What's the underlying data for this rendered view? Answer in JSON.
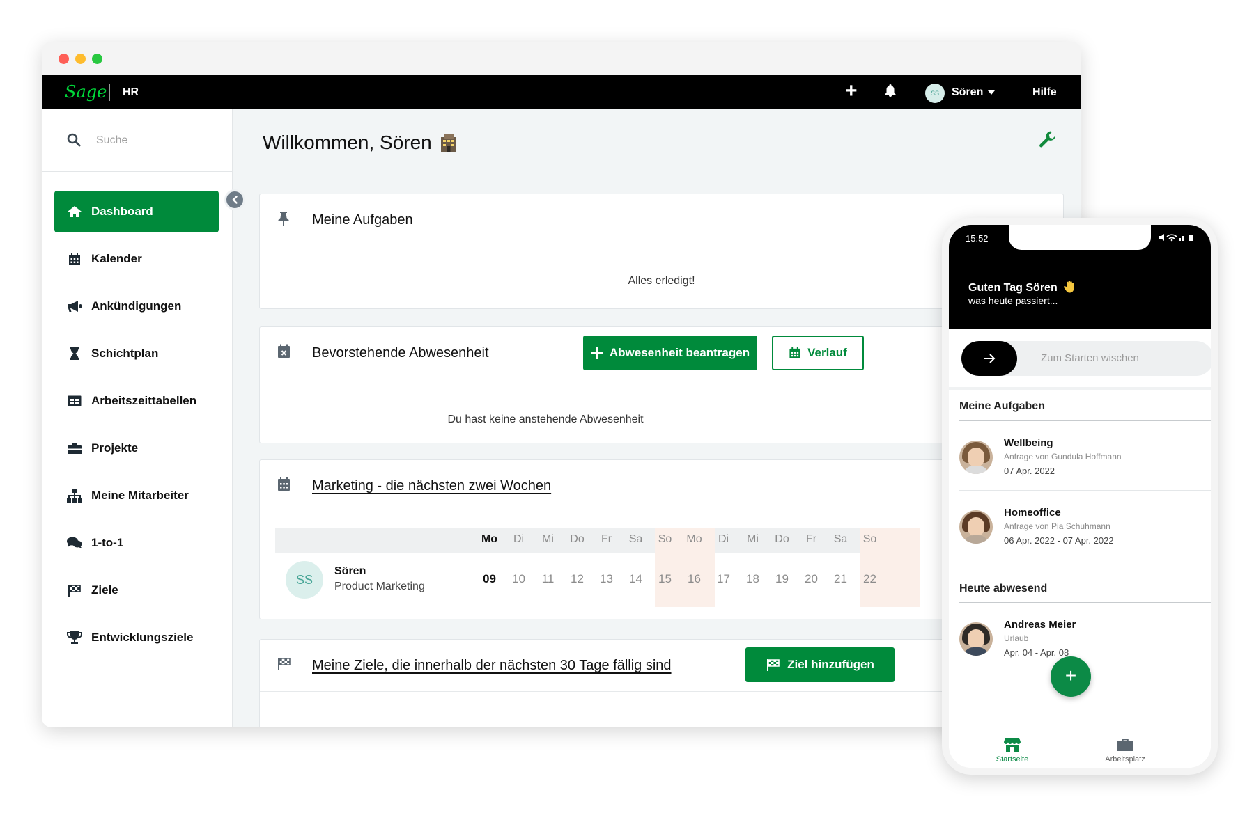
{
  "colors": {
    "brand_green": "#008a3b",
    "topbar": "#000000",
    "weekend": "#fbefe9",
    "sage_logo": "#00d639"
  },
  "topbar": {
    "logo_text": "Sage",
    "app_label": "HR",
    "add_icon": "plus-icon",
    "notification_icon": "bell-icon",
    "user_initials": "SS",
    "user_name": "Sören",
    "help_label": "Hilfe"
  },
  "sidebar": {
    "search_placeholder": "Suche",
    "items": [
      {
        "label": "Dashboard",
        "icon": "home-icon",
        "active": true
      },
      {
        "label": "Kalender",
        "icon": "calendar-icon",
        "active": false
      },
      {
        "label": "Ankündigungen",
        "icon": "megaphone-icon",
        "active": false
      },
      {
        "label": "Schichtplan",
        "icon": "hourglass-icon",
        "active": false
      },
      {
        "label": "Arbeitszeittabellen",
        "icon": "table-icon",
        "active": false
      },
      {
        "label": "Projekte",
        "icon": "briefcase-icon",
        "active": false
      },
      {
        "label": "Meine Mitarbeiter",
        "icon": "org-chart-icon",
        "active": false
      },
      {
        "label": "1-to-1",
        "icon": "chat-icon",
        "active": false
      },
      {
        "label": "Ziele",
        "icon": "flag-icon",
        "active": false
      },
      {
        "label": "Entwicklungsziele",
        "icon": "trophy-icon",
        "active": false
      }
    ]
  },
  "main": {
    "welcome": "Willkommen, Sören",
    "welcome_emoji": "office-building-icon",
    "settings_icon": "wrench-icon",
    "tasks": {
      "title": "Meine Aufgaben",
      "empty_text": "Alles erledigt!"
    },
    "absence": {
      "title": "Bevorstehende Abwesenheit",
      "request_button": "Abwesenheit beantragen",
      "history_button": "Verlauf",
      "empty_text": "Du hast keine anstehende Abwesenheit"
    },
    "team_calendar": {
      "title": "Marketing - die nächsten zwei Wochen",
      "days": [
        "Mo",
        "Di",
        "Mi",
        "Do",
        "Fr",
        "Sa",
        "So",
        "Mo",
        "Di",
        "Mi",
        "Do",
        "Fr",
        "Sa",
        "So"
      ],
      "dates": [
        "09",
        "10",
        "11",
        "12",
        "13",
        "14",
        "15",
        "16",
        "17",
        "18",
        "19",
        "20",
        "21",
        "22"
      ],
      "person": {
        "initials": "SS",
        "name": "Sören",
        "role": "Product Marketing"
      }
    },
    "goals": {
      "title": "Meine Ziele, die innerhalb der nächsten 30 Tage fällig sind",
      "add_button": "Ziel hinzufügen"
    }
  },
  "phone": {
    "time": "15:52",
    "greeting": "Guten Tag Sören",
    "subtitle": "was heute passiert...",
    "swipe_text": "Zum Starten wischen",
    "tasks_title": "Meine Aufgaben",
    "tasks": [
      {
        "title": "Wellbeing",
        "requester": "Anfrage von Gundula Hoffmann",
        "date": "07 Apr. 2022"
      },
      {
        "title": "Homeoffice",
        "requester": "Anfrage von Pia Schuhmann",
        "date": "06 Apr. 2022 - 07 Apr. 2022"
      }
    ],
    "absent_title": "Heute abwesend",
    "absent": [
      {
        "name": "Andreas Meier",
        "type": "Urlaub",
        "date": "Apr. 04 - Apr. 08"
      }
    ],
    "tabs": {
      "home": "Startseite",
      "workplace": "Arbeitsplatz"
    }
  }
}
